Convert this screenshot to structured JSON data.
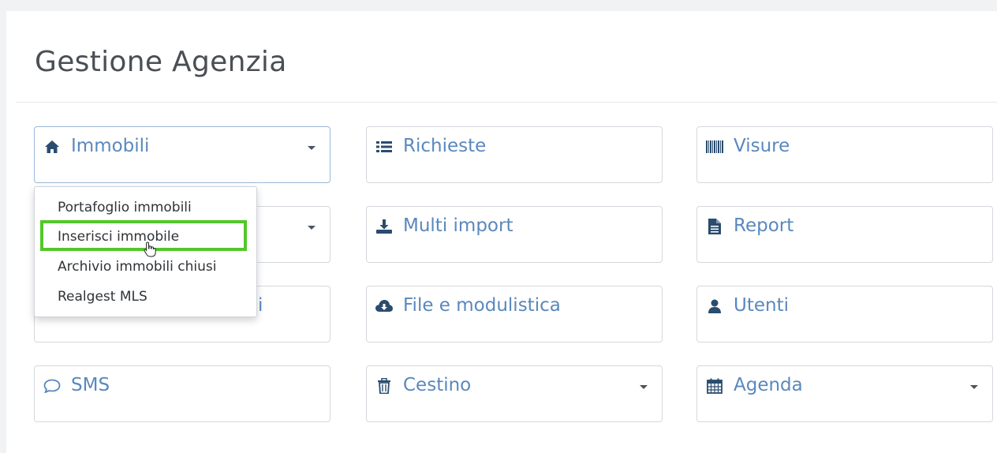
{
  "page": {
    "title": "Gestione Agenzia"
  },
  "tiles": [
    {
      "label": "Immobili",
      "icon": "home-icon"
    },
    {
      "label": "Richieste",
      "icon": "list-icon"
    },
    {
      "label": "Visure",
      "icon": "barcode-icon"
    },
    {
      "label": "",
      "icon": ""
    },
    {
      "label": "Multi import",
      "icon": "download-icon"
    },
    {
      "label": "Report",
      "icon": "file-text-icon"
    },
    {
      "label": "",
      "icon": ""
    },
    {
      "label": "File e modulistica",
      "icon": "cloud-download-icon"
    },
    {
      "label": "Utenti",
      "icon": "user-icon"
    },
    {
      "label": "SMS",
      "icon": "speech-bubble-icon"
    },
    {
      "label": "Cestino",
      "icon": "trash-icon"
    },
    {
      "label": "Agenda",
      "icon": "calendar-icon"
    }
  ],
  "dropdown": {
    "items": [
      "Portafoglio immobili",
      "Inserisci immobile",
      "Archivio immobili chiusi",
      "Realgest MLS"
    ],
    "highlighted": "Inserisci immobile"
  },
  "colors": {
    "accent": "#5a88bc",
    "icon": "#2a4c6e",
    "highlight": "#52c72b",
    "border": "#d4d8dd"
  }
}
